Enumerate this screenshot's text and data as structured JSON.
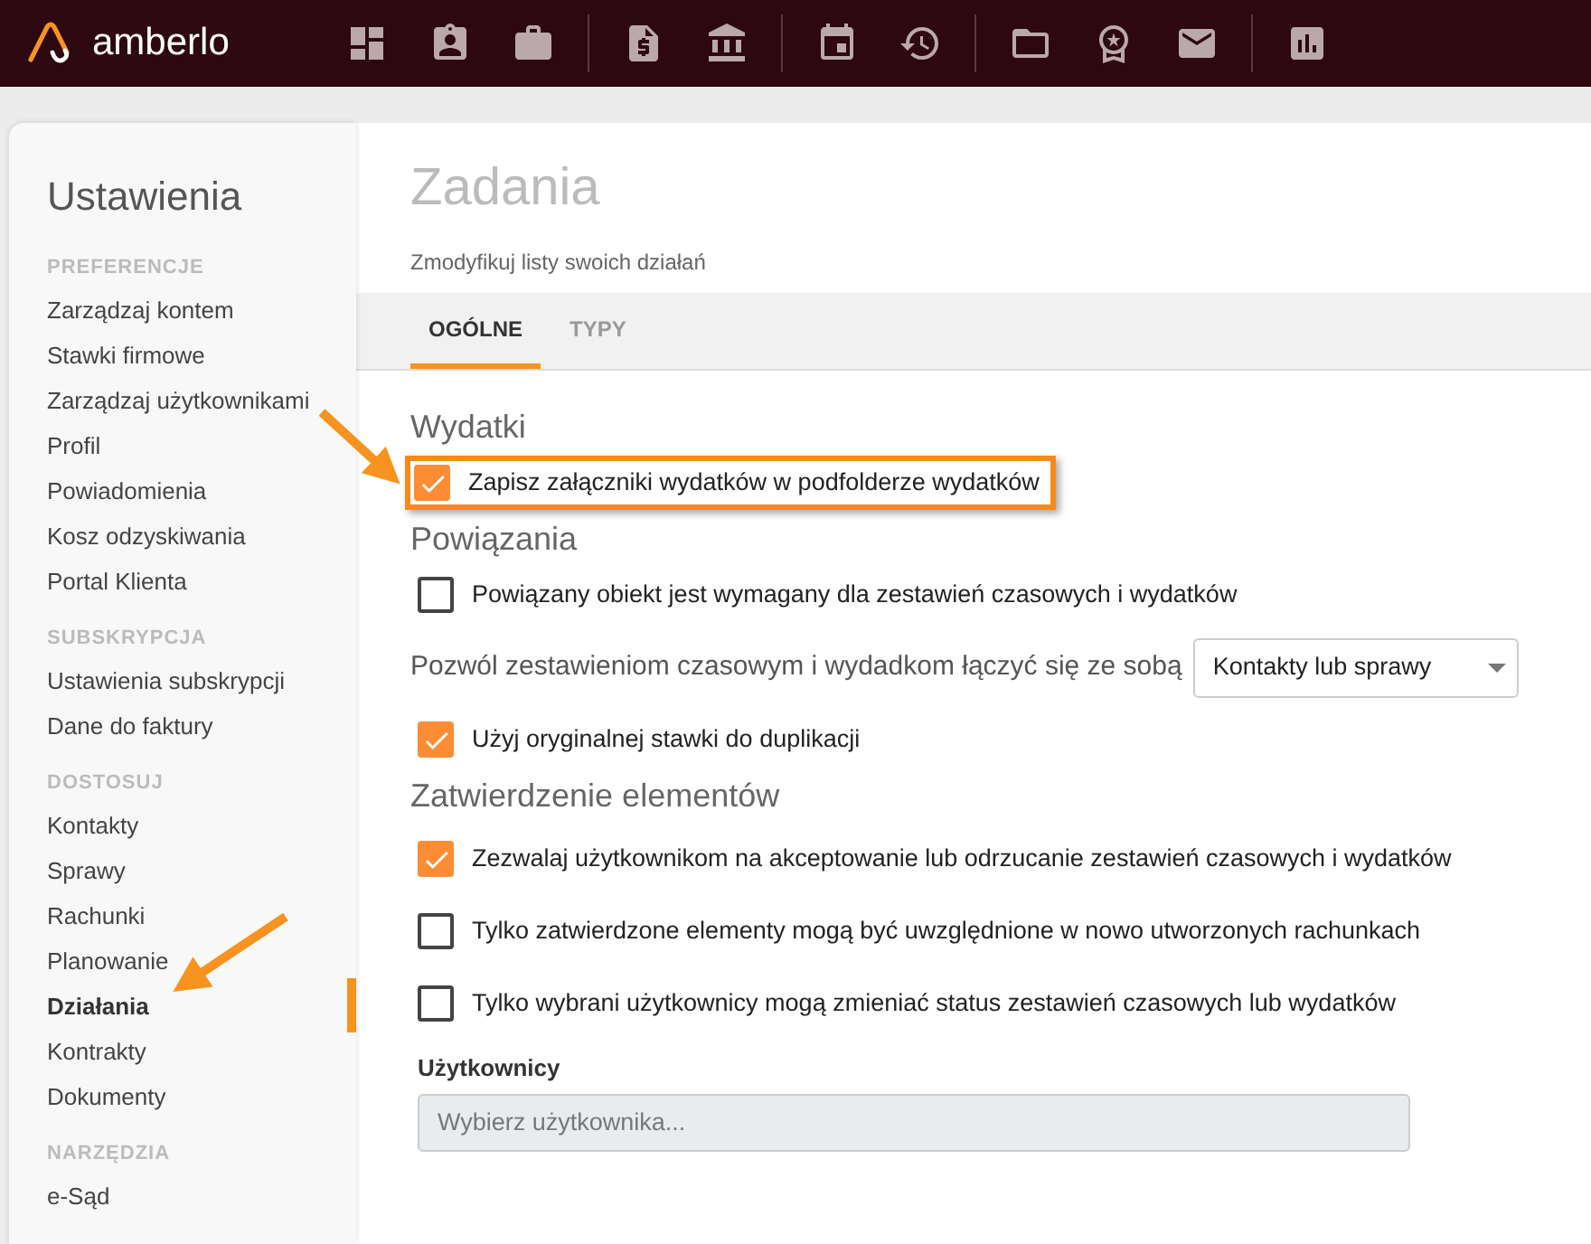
{
  "brand": {
    "name": "amberlo"
  },
  "sidebar": {
    "title": "Ustawienia",
    "sections": [
      {
        "heading": "PREFERENCJE",
        "items": [
          {
            "label": "Zarządzaj kontem",
            "selected": false
          },
          {
            "label": "Stawki firmowe",
            "selected": false
          },
          {
            "label": "Zarządzaj użytkownikami",
            "selected": false
          },
          {
            "label": "Profil",
            "selected": false
          },
          {
            "label": "Powiadomienia",
            "selected": false
          },
          {
            "label": "Kosz odzyskiwania",
            "selected": false
          },
          {
            "label": "Portal Klienta",
            "selected": false
          }
        ]
      },
      {
        "heading": "SUBSKRYPCJA",
        "items": [
          {
            "label": "Ustawienia subskrypcji",
            "selected": false
          },
          {
            "label": "Dane do faktury",
            "selected": false
          }
        ]
      },
      {
        "heading": "DOSTOSUJ",
        "items": [
          {
            "label": "Kontakty",
            "selected": false
          },
          {
            "label": "Sprawy",
            "selected": false
          },
          {
            "label": "Rachunki",
            "selected": false
          },
          {
            "label": "Planowanie",
            "selected": false
          },
          {
            "label": "Działania",
            "selected": true
          },
          {
            "label": "Kontrakty",
            "selected": false
          },
          {
            "label": "Dokumenty",
            "selected": false
          }
        ]
      },
      {
        "heading": "NARZĘDZIA",
        "items": [
          {
            "label": "e-Sąd",
            "selected": false
          }
        ]
      }
    ]
  },
  "page": {
    "title": "Zadania",
    "subtitle": "Zmodyfikuj listy swoich działań"
  },
  "tabs": [
    {
      "label": "OGÓLNE",
      "selected": true
    },
    {
      "label": "TYPY",
      "selected": false
    }
  ],
  "sections": [
    {
      "title": "Wydatki",
      "items": [
        {
          "kind": "checkbox",
          "label": "Zapisz załączniki wydatków w podfolderze wydatków",
          "checked": true,
          "highlighted": true
        }
      ]
    },
    {
      "title": "Powiązania",
      "items": [
        {
          "kind": "checkbox",
          "label": "Powiązany obiekt jest wymagany dla zestawień czasowych i wydatków",
          "checked": false,
          "highlighted": false
        },
        {
          "kind": "select",
          "label": "Pozwól zestawieniom czasowym i wydadkom łączyć się ze sobą",
          "value": "Kontakty lub sprawy"
        },
        {
          "kind": "checkbox",
          "label": "Użyj oryginalnej stawki do duplikacji",
          "checked": true,
          "highlighted": false
        }
      ]
    },
    {
      "title": "Zatwierdzenie elementów",
      "items": [
        {
          "kind": "checkbox",
          "label": "Zezwalaj użytkownikom na akceptowanie lub odrzucanie zestawień czasowych i wydatków",
          "checked": true,
          "highlighted": false
        },
        {
          "kind": "checkbox",
          "label": "Tylko zatwierdzone elementy mogą być uwzględnione w nowo utworzonych rachunkach",
          "checked": false,
          "highlighted": false
        },
        {
          "kind": "checkbox",
          "label": "Tylko wybrani użytkownicy mogą zmieniać status zestawień czasowych lub wydatków",
          "checked": false,
          "highlighted": false
        },
        {
          "kind": "field",
          "label": "Użytkownicy",
          "placeholder": "Wybierz użytkownika...",
          "disabled": true
        }
      ]
    }
  ]
}
